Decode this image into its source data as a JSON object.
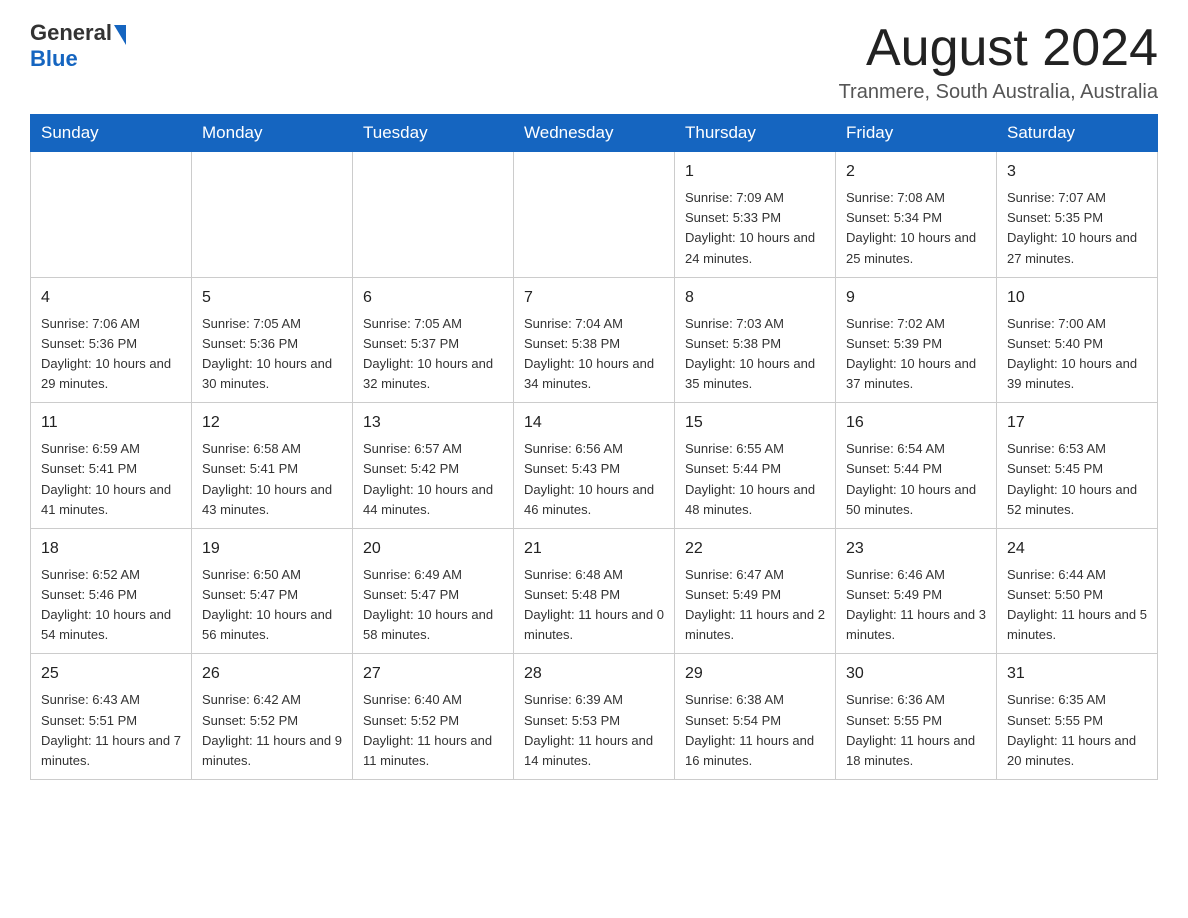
{
  "header": {
    "logo_general": "General",
    "logo_blue": "Blue",
    "month_title": "August 2024",
    "location": "Tranmere, South Australia, Australia"
  },
  "weekdays": [
    "Sunday",
    "Monday",
    "Tuesday",
    "Wednesday",
    "Thursday",
    "Friday",
    "Saturday"
  ],
  "weeks": [
    [
      {
        "day": "",
        "info": ""
      },
      {
        "day": "",
        "info": ""
      },
      {
        "day": "",
        "info": ""
      },
      {
        "day": "",
        "info": ""
      },
      {
        "day": "1",
        "info": "Sunrise: 7:09 AM\nSunset: 5:33 PM\nDaylight: 10 hours and 24 minutes."
      },
      {
        "day": "2",
        "info": "Sunrise: 7:08 AM\nSunset: 5:34 PM\nDaylight: 10 hours and 25 minutes."
      },
      {
        "day": "3",
        "info": "Sunrise: 7:07 AM\nSunset: 5:35 PM\nDaylight: 10 hours and 27 minutes."
      }
    ],
    [
      {
        "day": "4",
        "info": "Sunrise: 7:06 AM\nSunset: 5:36 PM\nDaylight: 10 hours and 29 minutes."
      },
      {
        "day": "5",
        "info": "Sunrise: 7:05 AM\nSunset: 5:36 PM\nDaylight: 10 hours and 30 minutes."
      },
      {
        "day": "6",
        "info": "Sunrise: 7:05 AM\nSunset: 5:37 PM\nDaylight: 10 hours and 32 minutes."
      },
      {
        "day": "7",
        "info": "Sunrise: 7:04 AM\nSunset: 5:38 PM\nDaylight: 10 hours and 34 minutes."
      },
      {
        "day": "8",
        "info": "Sunrise: 7:03 AM\nSunset: 5:38 PM\nDaylight: 10 hours and 35 minutes."
      },
      {
        "day": "9",
        "info": "Sunrise: 7:02 AM\nSunset: 5:39 PM\nDaylight: 10 hours and 37 minutes."
      },
      {
        "day": "10",
        "info": "Sunrise: 7:00 AM\nSunset: 5:40 PM\nDaylight: 10 hours and 39 minutes."
      }
    ],
    [
      {
        "day": "11",
        "info": "Sunrise: 6:59 AM\nSunset: 5:41 PM\nDaylight: 10 hours and 41 minutes."
      },
      {
        "day": "12",
        "info": "Sunrise: 6:58 AM\nSunset: 5:41 PM\nDaylight: 10 hours and 43 minutes."
      },
      {
        "day": "13",
        "info": "Sunrise: 6:57 AM\nSunset: 5:42 PM\nDaylight: 10 hours and 44 minutes."
      },
      {
        "day": "14",
        "info": "Sunrise: 6:56 AM\nSunset: 5:43 PM\nDaylight: 10 hours and 46 minutes."
      },
      {
        "day": "15",
        "info": "Sunrise: 6:55 AM\nSunset: 5:44 PM\nDaylight: 10 hours and 48 minutes."
      },
      {
        "day": "16",
        "info": "Sunrise: 6:54 AM\nSunset: 5:44 PM\nDaylight: 10 hours and 50 minutes."
      },
      {
        "day": "17",
        "info": "Sunrise: 6:53 AM\nSunset: 5:45 PM\nDaylight: 10 hours and 52 minutes."
      }
    ],
    [
      {
        "day": "18",
        "info": "Sunrise: 6:52 AM\nSunset: 5:46 PM\nDaylight: 10 hours and 54 minutes."
      },
      {
        "day": "19",
        "info": "Sunrise: 6:50 AM\nSunset: 5:47 PM\nDaylight: 10 hours and 56 minutes."
      },
      {
        "day": "20",
        "info": "Sunrise: 6:49 AM\nSunset: 5:47 PM\nDaylight: 10 hours and 58 minutes."
      },
      {
        "day": "21",
        "info": "Sunrise: 6:48 AM\nSunset: 5:48 PM\nDaylight: 11 hours and 0 minutes."
      },
      {
        "day": "22",
        "info": "Sunrise: 6:47 AM\nSunset: 5:49 PM\nDaylight: 11 hours and 2 minutes."
      },
      {
        "day": "23",
        "info": "Sunrise: 6:46 AM\nSunset: 5:49 PM\nDaylight: 11 hours and 3 minutes."
      },
      {
        "day": "24",
        "info": "Sunrise: 6:44 AM\nSunset: 5:50 PM\nDaylight: 11 hours and 5 minutes."
      }
    ],
    [
      {
        "day": "25",
        "info": "Sunrise: 6:43 AM\nSunset: 5:51 PM\nDaylight: 11 hours and 7 minutes."
      },
      {
        "day": "26",
        "info": "Sunrise: 6:42 AM\nSunset: 5:52 PM\nDaylight: 11 hours and 9 minutes."
      },
      {
        "day": "27",
        "info": "Sunrise: 6:40 AM\nSunset: 5:52 PM\nDaylight: 11 hours and 11 minutes."
      },
      {
        "day": "28",
        "info": "Sunrise: 6:39 AM\nSunset: 5:53 PM\nDaylight: 11 hours and 14 minutes."
      },
      {
        "day": "29",
        "info": "Sunrise: 6:38 AM\nSunset: 5:54 PM\nDaylight: 11 hours and 16 minutes."
      },
      {
        "day": "30",
        "info": "Sunrise: 6:36 AM\nSunset: 5:55 PM\nDaylight: 11 hours and 18 minutes."
      },
      {
        "day": "31",
        "info": "Sunrise: 6:35 AM\nSunset: 5:55 PM\nDaylight: 11 hours and 20 minutes."
      }
    ]
  ]
}
